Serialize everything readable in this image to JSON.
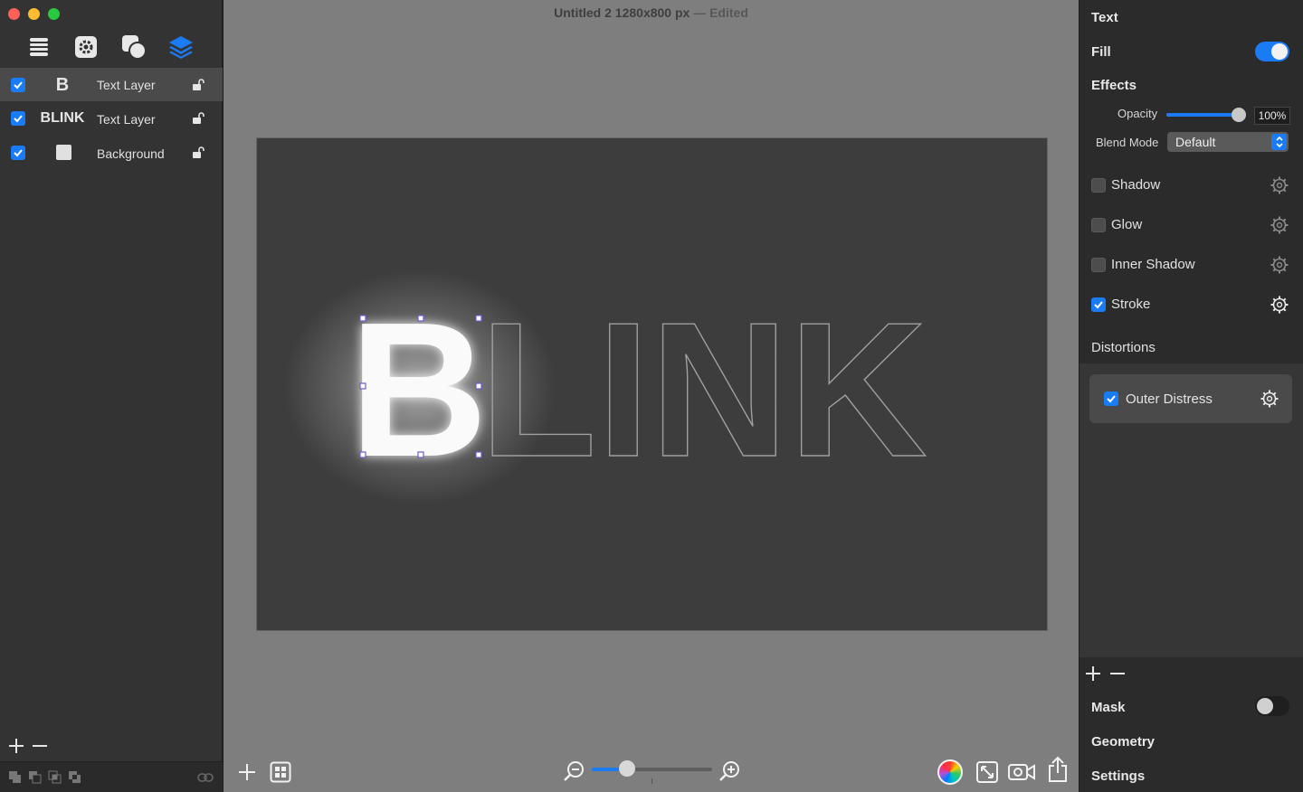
{
  "window": {
    "title": "Untitled 2 1280x800 px",
    "title_separator": "—",
    "edited": "Edited"
  },
  "toolbar": {
    "icons": [
      "list-icon",
      "gear-icon",
      "shapes-icon",
      "layers-icon"
    ],
    "active_icon": "layers-icon",
    "accent": "#1a7cf5"
  },
  "layers": [
    {
      "thumb": "B",
      "name": "Text Layer",
      "checked": true,
      "selected": true
    },
    {
      "thumb": "BLINK",
      "name": "Text Layer",
      "checked": true,
      "selected": false
    },
    {
      "thumb": "",
      "name": "Background",
      "checked": true,
      "selected": false
    }
  ],
  "canvas": {
    "first_letter": "B",
    "rest_letters": "LINK"
  },
  "inspector": {
    "text_title": "Text",
    "fill_label": "Fill",
    "fill_on": true,
    "effects_title": "Effects",
    "opacity_label": "Opacity",
    "opacity_value": "100%",
    "opacity_fraction": 1.0,
    "blend_label": "Blend Mode",
    "blend_value": "Default",
    "effects": [
      {
        "name": "Shadow",
        "checked": false
      },
      {
        "name": "Glow",
        "checked": false
      },
      {
        "name": "Inner Shadow",
        "checked": false
      },
      {
        "name": "Stroke",
        "checked": true
      }
    ],
    "distortions_title": "Distortions",
    "distortions": [
      {
        "name": "Outer Distress",
        "checked": true
      }
    ],
    "mask_label": "Mask",
    "mask_on": false,
    "geometry_label": "Geometry",
    "settings_label": "Settings"
  },
  "zoom": {
    "fraction": 0.29
  }
}
